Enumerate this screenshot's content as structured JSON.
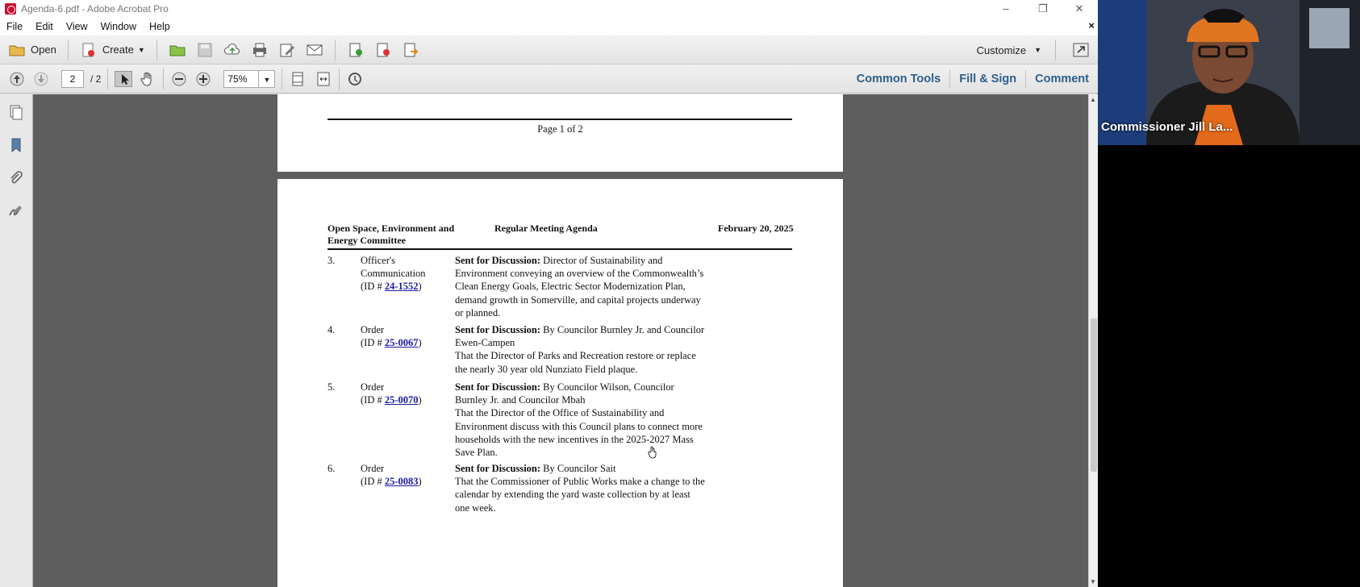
{
  "window": {
    "title": "Agenda-6.pdf - Adobe Acrobat Pro",
    "controls": [
      "–",
      "❐",
      "✕"
    ]
  },
  "menu": {
    "items": [
      "File",
      "Edit",
      "View",
      "Window",
      "Help"
    ]
  },
  "toolbar": {
    "open_label": "Open",
    "create_label": "Create",
    "customize_label": "Customize"
  },
  "nav": {
    "page_current": "2",
    "page_total": "/ 2",
    "zoom": "75%"
  },
  "panels": {
    "common_tools": "Common Tools",
    "fill_sign": "Fill & Sign",
    "comment": "Comment"
  },
  "document": {
    "page1_footer": "Page 1 of 2",
    "header_left_1": "Open Space, Environment and",
    "header_left_2": "Energy Committee",
    "header_center": "Regular Meeting Agenda",
    "header_right": "February 20, 2025",
    "items": [
      {
        "num": "3.",
        "kind_1": "Officer's",
        "kind_2": "Communication",
        "id_prefix": "(ID # ",
        "id": "24-1552",
        "id_suffix": ")",
        "bold": "Sent for Discussion:",
        "text": " Director of Sustainability and Environment conveying an overview of the Commonwealth’s Clean Energy Goals, Electric Sector Modernization Plan, demand growth in Somerville, and capital projects underway or planned."
      },
      {
        "num": "4.",
        "kind_1": "Order",
        "id_prefix": "(ID # ",
        "id": "25-0067",
        "id_suffix": ")",
        "bold": "Sent for Discussion:",
        "text": " By Councilor Burnley Jr. and Councilor Ewen-Campen",
        "text2": "That the Director of Parks and Recreation restore or replace the nearly 30 year old Nunziato Field plaque."
      },
      {
        "num": "5.",
        "kind_1": "Order",
        "id_prefix": "(ID # ",
        "id": "25-0070",
        "id_suffix": ")",
        "bold": "Sent for Discussion:",
        "text": " By Councilor Wilson, Councilor Burnley Jr. and Councilor Mbah",
        "text2": "That the Director of the Office of Sustainability and Environment discuss with this Council plans to connect more households with the new incentives in the 2025-2027 Mass Save Plan."
      },
      {
        "num": "6.",
        "kind_1": "Order",
        "id_prefix": "(ID # ",
        "id": "25-0083",
        "id_suffix": ")",
        "bold": "Sent for Discussion:",
        "text": " By Councilor Sait",
        "text2": "That the Commissioner of Public Works make a change to the calendar by extending the yard waste collection by at least one week."
      }
    ]
  },
  "video": {
    "participant_name": "Commissioner Jill La..."
  }
}
